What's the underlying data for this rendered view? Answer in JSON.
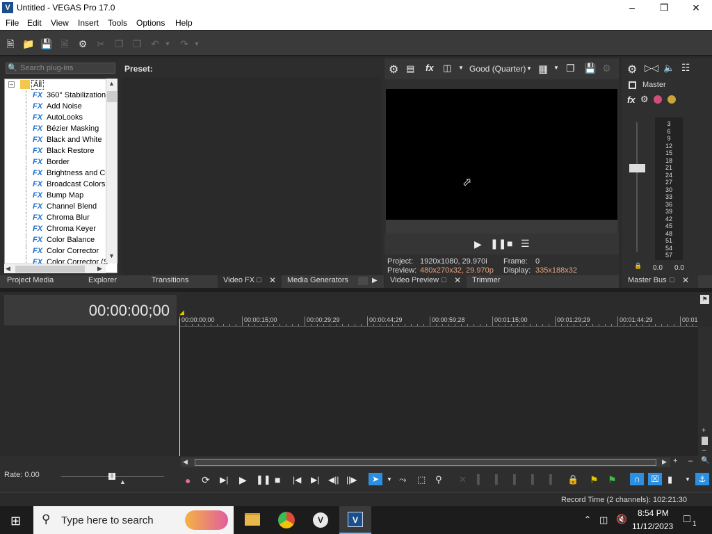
{
  "window": {
    "title": "Untitled - VEGAS Pro 17.0",
    "logo": "V"
  },
  "menu": [
    "File",
    "Edit",
    "View",
    "Insert",
    "Tools",
    "Options",
    "Help"
  ],
  "plugins": {
    "search_placeholder": "Search plug-ins",
    "preset_label": "Preset:",
    "root": "All",
    "fx_badge": "FX",
    "items": [
      "360° Stabilization",
      "Add Noise",
      "AutoLooks",
      "Bézier Masking",
      "Black and White",
      "Black Restore",
      "Border",
      "Brightness and Co",
      "Broadcast Colors",
      "Bump Map",
      "Channel Blend",
      "Chroma Blur",
      "Chroma Keyer",
      "Color Balance",
      "Color Corrector",
      "Color Corrector (S"
    ]
  },
  "tabs_left": [
    "Project Media",
    "Explorer",
    "Transitions",
    "Video FX",
    "Media Generators"
  ],
  "preview": {
    "quality": "Good (Quarter)",
    "project_label": "Project:",
    "project_value": "1920x1080, 29.970i",
    "preview_label": "Preview:",
    "preview_value": "480x270x32, 29.970p",
    "frame_label": "Frame:",
    "frame_value": "0",
    "display_label": "Display:",
    "display_value": "335x188x32",
    "tabs": [
      "Video Preview",
      "Trimmer"
    ]
  },
  "master": {
    "label": "Master",
    "scale": [
      "3",
      "6",
      "9",
      "12",
      "15",
      "18",
      "21",
      "24",
      "27",
      "30",
      "33",
      "36",
      "39",
      "42",
      "45",
      "48",
      "51",
      "54",
      "57"
    ],
    "left_level": "0.0",
    "right_level": "0.0",
    "tab": "Master Bus"
  },
  "timeline": {
    "timecode": "00:00:00;00",
    "ruler": [
      "00:00:00;00",
      "00:00:15;00",
      "00:00:29;29",
      "00:00:44;29",
      "00:00:59;28",
      "00:01:15;00",
      "00:01:29;29",
      "00:01:44;29",
      "00:01"
    ],
    "rate": "Rate: 0.00"
  },
  "status": {
    "record_time": "Record Time (2 channels): 102:21:30"
  },
  "taskbar": {
    "search": "Type here to search",
    "time": "8:54 PM",
    "date": "11/12/2023",
    "notif": "1"
  }
}
